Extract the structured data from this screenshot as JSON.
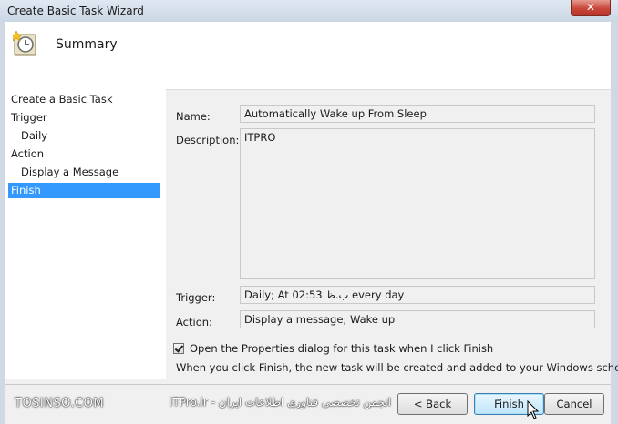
{
  "window": {
    "title": "Create Basic Task Wizard",
    "close_glyph": "✕"
  },
  "header": {
    "title": "Summary",
    "icon": "scheduled-task-icon"
  },
  "nav": {
    "items": [
      {
        "label": "Create a Basic Task",
        "selected": false
      },
      {
        "label": "Trigger",
        "selected": false
      },
      {
        "label": "Daily",
        "selected": false
      },
      {
        "label": "Action",
        "selected": false
      },
      {
        "label": "Display a Message",
        "selected": false
      },
      {
        "label": "Finish",
        "selected": true
      }
    ]
  },
  "summary": {
    "name_label": "Name:",
    "name_value": "Automatically Wake up From Sleep",
    "description_label": "Description:",
    "description_value": "ITPRO",
    "trigger_label": "Trigger:",
    "trigger_value": "Daily; At 02:53 ب.ظ every day",
    "action_label": "Action:",
    "action_value": "Display a message; Wake up"
  },
  "options": {
    "open_properties_label": "Open the Properties dialog for this task when I click Finish",
    "open_properties_checked": true,
    "info_text": "When you click Finish, the new task will be created and added to your Windows schedule."
  },
  "footer": {
    "back_label": "< Back",
    "finish_label": "Finish",
    "cancel_label": "Cancel"
  },
  "watermarks": {
    "left": "TOSINSO.COM",
    "center": "ITPro.ir - انجمن تخصصی فناوری اطلاعات ایران"
  },
  "colors": {
    "selection": "#3399ff",
    "client_bg": "#f0f0f0"
  }
}
